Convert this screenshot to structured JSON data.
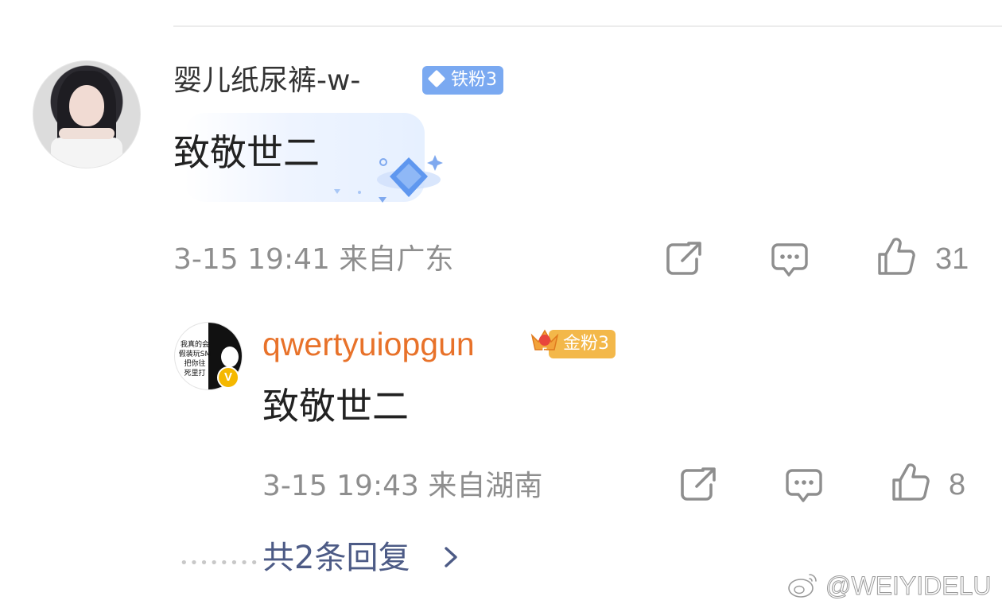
{
  "main_comment": {
    "username": "婴儿纸尿裤-w-",
    "fan_badge": "铁粉3",
    "text": "致敬世二",
    "meta": "3-15 19:41  来自广东",
    "like_count": "31"
  },
  "reply_comment": {
    "username": "qwertyuiopgun",
    "fan_badge": "金粉3",
    "avatar_text": "我真的会\n假装玩SM\n把你往\n死里打",
    "verified_badge": "V",
    "text": "致敬世二",
    "meta": "3-15 19:43  来自湖南",
    "like_count": "8"
  },
  "replies_link": "共2条回复",
  "watermark": "@WEIYIDELU",
  "colors": {
    "username_main": "#333333",
    "username_reply": "#e8722a",
    "meta": "#8e8e8e",
    "link": "#4d5b86",
    "badge_iron": "#7aa9f1",
    "badge_gold": "#f3b84a"
  },
  "icons": [
    "share-icon",
    "comment-icon",
    "like-icon",
    "chevron-right-icon",
    "weibo-logo-icon",
    "diamond-icon",
    "crown-icon"
  ]
}
